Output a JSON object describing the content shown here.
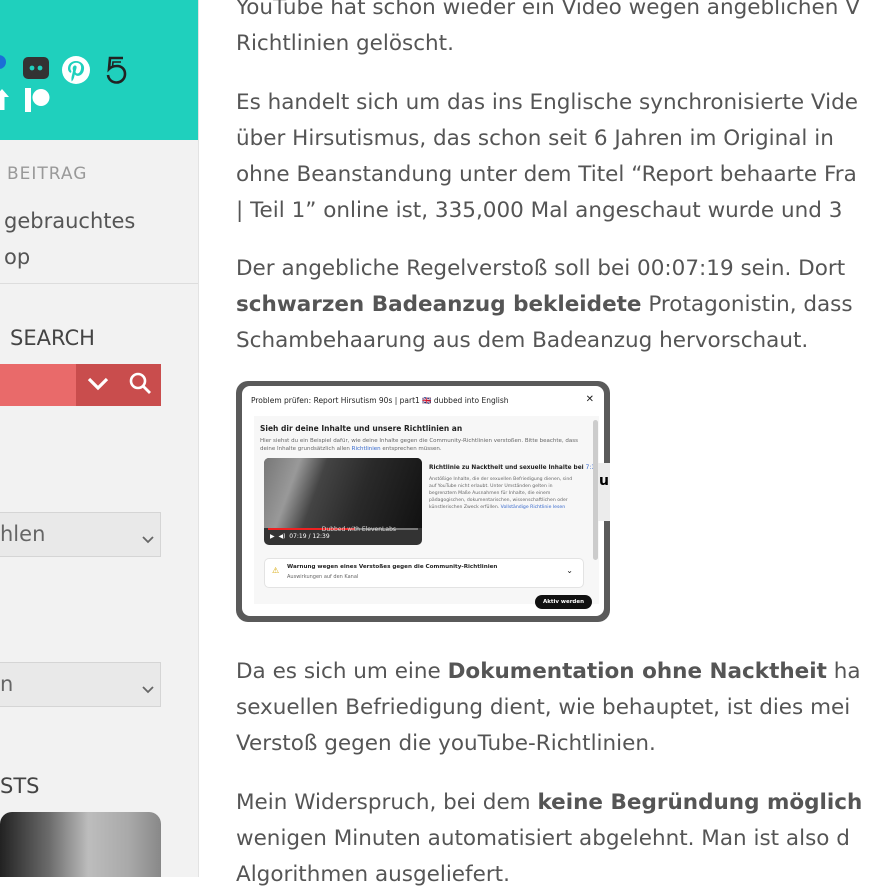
{
  "sidebar": {
    "header_color": "#1fd0bd",
    "social_icons": [
      "discord-icon",
      "pinterest-icon",
      "fivehundredpx-icon",
      "patreon-icon",
      "arrow-up-icon",
      "blue-circle-icon"
    ],
    "prev_post_label": "BEITRAG",
    "prev_post_link_line1": "gebrauchtes",
    "prev_post_link_line2": "op",
    "search_heading": "SEARCH",
    "select1_value": "hlen",
    "select2_value": "n",
    "posts_heading": "STS"
  },
  "article": {
    "p1_line1": "YouTube hat schon wieder ein Video wegen angeblichen V",
    "p1_line2": "Richtlinien gelöscht.",
    "p2_line1": "Es handelt sich um das ins Englische synchronisierte Vide",
    "p2_line2": "über Hirsutismus, das schon seit 6 Jahren im Original in",
    "p2_line3": "ohne Beanstandung unter dem Titel “Report behaarte Fra",
    "p2_line4": "| Teil 1” online ist, 335,000 Mal angeschaut wurde und 3",
    "p3_line1": "Der angebliche Regelverstoß soll bei 00:07:19 sein. Dort",
    "p3_line2_bold": "schwarzen Badeanzug bekleidete",
    "p3_line2_rest": " Protagonistin, dass",
    "p3_line3": "Schambehaarung aus dem Badeanzug hervorschaut.",
    "p4_line1_pre": "Da es sich um eine ",
    "p4_line1_bold": "Dokumentation ohne Nacktheit",
    "p4_line1_post": " ha",
    "p4_line2": "sexuellen Befriedigung dient, wie behauptet, ist dies mei",
    "p4_line3": "Verstoß gegen die youTube-Richtlinien.",
    "p5_line1_pre": "Mein Widerspruch, bei dem ",
    "p5_line1_bold": "keine Begründung möglich",
    "p5_line2": "wenigen Minuten automatisiert abgelehnt. Man ist also d",
    "p5_line3": "Algorithmen ausgeliefert."
  },
  "screenshot": {
    "title": "Problem prüfen: Report Hirsutism 90s | part1 🇬🇧 dubbed into English",
    "heading": "Sieh dir deine Inhalte und unsere Richtlinien an",
    "description": "Hier siehst du ein Beispiel dafür, wie deine Inhalte gegen die Community-Richtlinien verstoßen. Bitte beachte, dass deine Inhalte grundsätzlich allen",
    "description_link": "Richtlinien",
    "description_end": " entsprechen müssen.",
    "video_time": "07:19 / 12:39",
    "video_watermark": "Dubbed with ElevenLabs",
    "policy_title": "Richtlinie zu Nacktheit und sexuelle Inhalte bei ",
    "policy_time": "7:19",
    "policy_text": "Anstößige Inhalte, die der sexuellen Befriedigung dienen, sind auf YouTube nicht erlaubt. Unter Umständen gelten in begrenztem Maße Ausnahmen für Inhalte, die einem pädagogischen, dokumentarischen, wissenschaftlichen oder künstlerischen Zweck erfüllen. ",
    "policy_link": "Vollständige Richtlinie lesen",
    "warning_title": "Warnung wegen eines Verstoßes gegen die Community-Richtlinien",
    "warning_sub": "Auswirkungen auf den Kanal",
    "action_button": "Aktiv werden",
    "edge_letter": "u",
    "progress_fraction": 0.58
  }
}
